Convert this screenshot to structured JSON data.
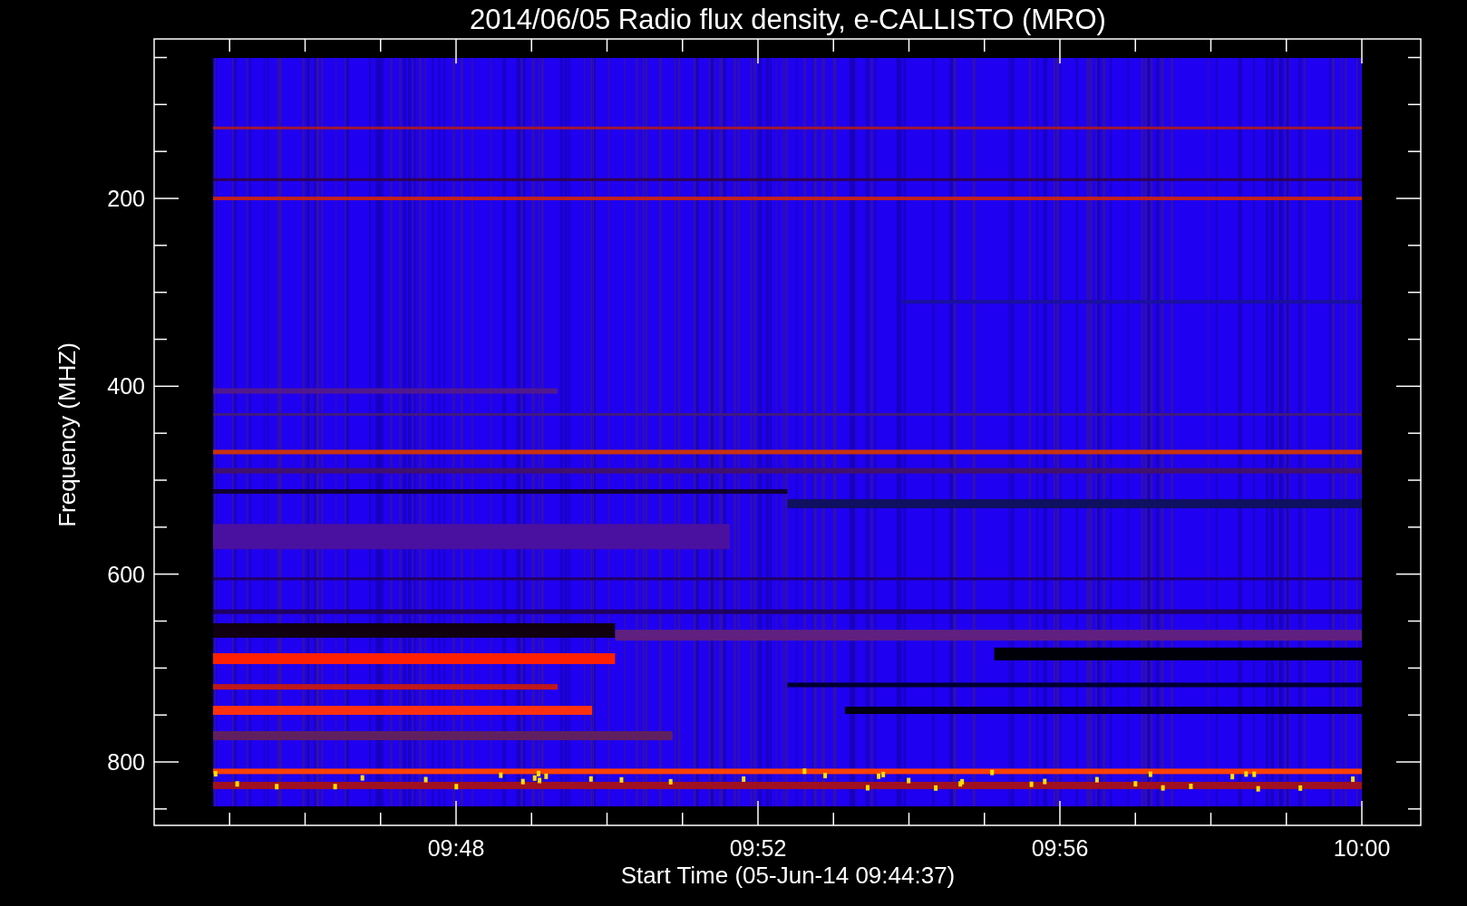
{
  "title": "2014/06/05  Radio flux density, e-CALLISTO (MRO)",
  "y_axis": {
    "label": "Frequency (MHZ)",
    "ticks": [
      "200",
      "400",
      "600",
      "800"
    ]
  },
  "x_axis": {
    "label": "Start Time (05-Jun-14 09:44:37)",
    "ticks": [
      "09:48",
      "09:52",
      "09:56",
      "10:00"
    ]
  }
}
